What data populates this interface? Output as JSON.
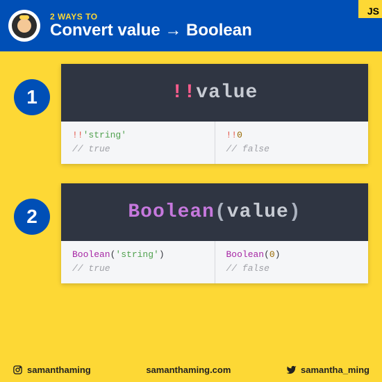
{
  "header": {
    "subtitle": "2 WAYS TO",
    "title": "Convert value → Boolean",
    "badge": "JS"
  },
  "methods": [
    {
      "num": "1",
      "code_op": "!!",
      "code_arg": "value",
      "examples": [
        {
          "op": "!!",
          "str": "'string'",
          "comment": "// true"
        },
        {
          "op": "!!",
          "num": "0",
          "comment": "// false"
        }
      ]
    },
    {
      "num": "2",
      "code_fn": "Boolean",
      "code_arg": "value",
      "examples": [
        {
          "fn": "Boolean",
          "str": "'string'",
          "comment": "// true"
        },
        {
          "fn": "Boolean",
          "num": "0",
          "comment": "// false"
        }
      ]
    }
  ],
  "footer": {
    "instagram": "samanthaming",
    "site": "samanthaming.com",
    "twitter": "samantha_ming"
  }
}
